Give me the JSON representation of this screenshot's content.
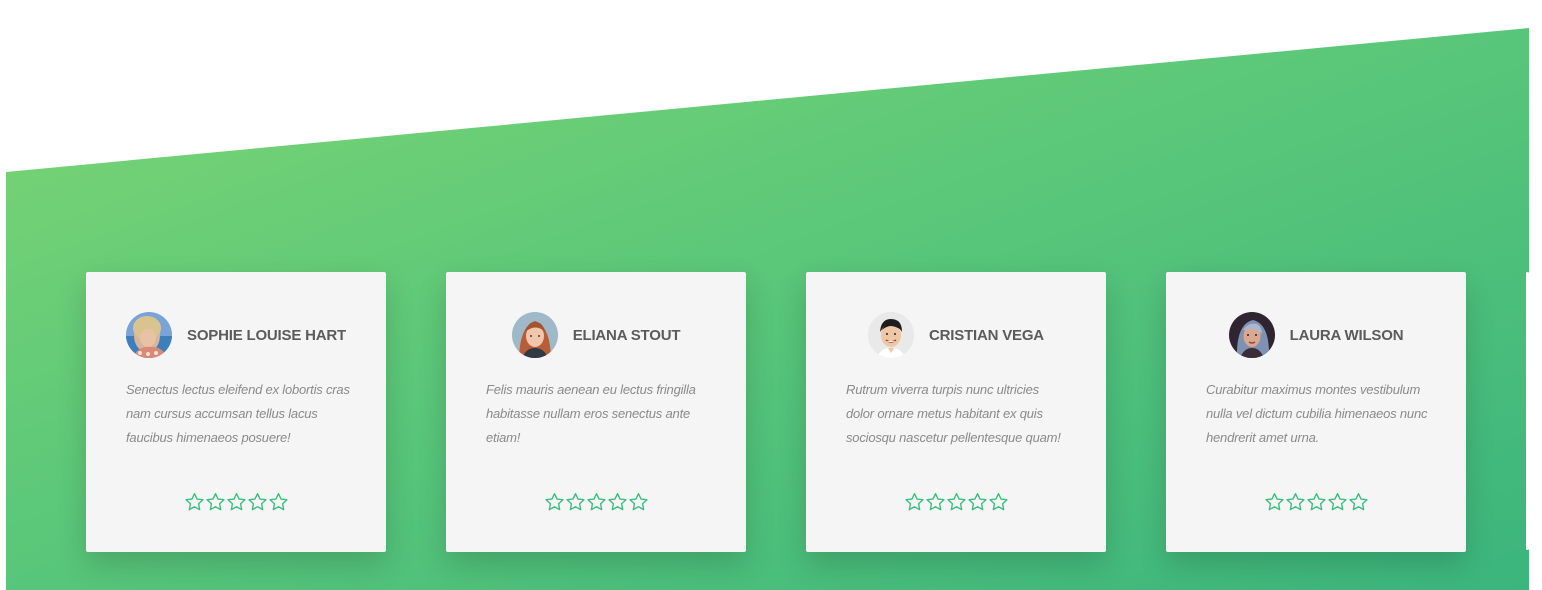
{
  "colors": {
    "gradient_start": "#7fd672",
    "gradient_end": "#3bb57d",
    "card_background": "#f5f5f5",
    "star_color": "#3fbf7f",
    "name_color": "#5b5b5b",
    "quote_color": "#8a8a8a"
  },
  "testimonials": [
    {
      "name": "SOPHIE LOUISE HART",
      "quote": "Senectus lectus eleifend ex lobortis cras nam cursus accumsan tellus lacus faucibus himenaeos posuere!",
      "avatar": "avatar-photo",
      "rating": 0,
      "max_rating": 5
    },
    {
      "name": "ELIANA STOUT",
      "quote": "Felis mauris aenean eu lectus fringilla habitasse nullam eros senectus ante etiam!",
      "avatar": "avatar-photo",
      "rating": 0,
      "max_rating": 5
    },
    {
      "name": "CRISTIAN VEGA",
      "quote": "Rutrum viverra turpis nunc ultricies dolor ornare metus habitant ex quis sociosqu nascetur pellentesque quam!",
      "avatar": "avatar-photo",
      "rating": 0,
      "max_rating": 5
    },
    {
      "name": "LAURA WILSON",
      "quote": "Curabitur maximus montes vestibulum nulla vel dictum cubilia himenaeos nunc hendrerit amet urna.",
      "avatar": "avatar-photo",
      "rating": 0,
      "max_rating": 5
    }
  ],
  "icons": {
    "star": "star-outline-icon"
  }
}
